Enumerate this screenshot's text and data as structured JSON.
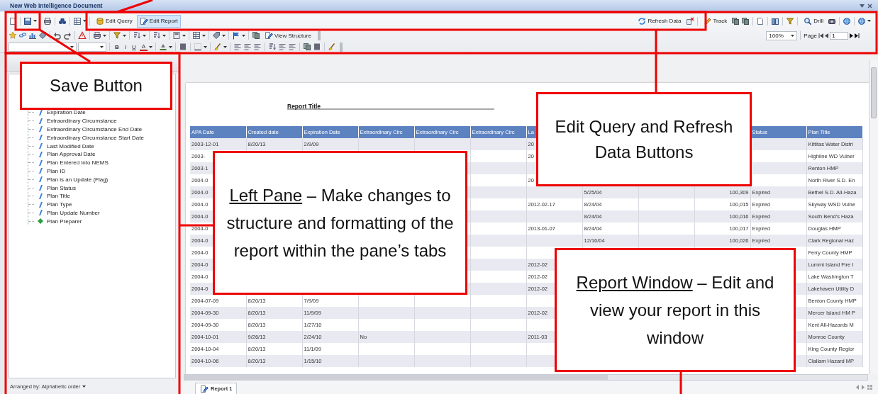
{
  "window": {
    "title": "New Web Intelligence Document"
  },
  "toolbar": {
    "mode_buttons": [
      {
        "label": "Edit Query",
        "selected": false
      },
      {
        "label": "Edit Report",
        "selected": true
      }
    ],
    "refresh_button": {
      "label": "Refresh Data"
    },
    "track_button": {
      "label": "Track"
    },
    "drill_button": {
      "label": "Drill"
    },
    "view_structure_button": {
      "label": "View Structure"
    },
    "zoom": {
      "value": "100%"
    },
    "page_label": "Page",
    "page_field": {
      "value": "1"
    },
    "format_buttons": [
      {
        "label": "B",
        "kind": "bold"
      },
      {
        "label": "I",
        "kind": "italic"
      },
      {
        "label": "U",
        "kind": "underline"
      },
      {
        "label": "A",
        "kind": "color"
      }
    ]
  },
  "left_pane": {
    "objects": [
      {
        "label": "Expiration Date",
        "kind": "detail"
      },
      {
        "label": "Extraordinary Circumstance",
        "kind": "detail"
      },
      {
        "label": "Extraordinary Circumstance End Date",
        "kind": "detail"
      },
      {
        "label": "Extraordinary Circumstance Start Date",
        "kind": "detail"
      },
      {
        "label": "Last Modified Date",
        "kind": "detail"
      },
      {
        "label": "Plan Approval Date",
        "kind": "detail"
      },
      {
        "label": "Plan Entered into NEMS",
        "kind": "detail"
      },
      {
        "label": "Plan ID",
        "kind": "detail"
      },
      {
        "label": "Plan is an Update (Flag)",
        "kind": "detail"
      },
      {
        "label": "Plan Status",
        "kind": "detail"
      },
      {
        "label": "Plan Title",
        "kind": "detail"
      },
      {
        "label": "Plan Type",
        "kind": "detail"
      },
      {
        "label": "Plan Update Number",
        "kind": "detail"
      },
      {
        "label": "Plan Preparer",
        "kind": "dimension"
      }
    ],
    "arranged_by": "Arranged by: Alphabetic order"
  },
  "report": {
    "title": "Report Title",
    "columns": [
      "APA Date",
      "Created date",
      "Expiration Date",
      "Extraordinary Circ",
      "Extraordinary Circ",
      "Extraordinary Circ",
      "La",
      null,
      null,
      null,
      "Status",
      "Plan Title"
    ],
    "rows": [
      [
        "2003-12-01",
        "8/20/13",
        "2/9/09",
        null,
        null,
        null,
        "20",
        null,
        null,
        null,
        null,
        "Kittitas Water Distri"
      ],
      [
        "2003-",
        null,
        null,
        null,
        null,
        null,
        "20",
        null,
        null,
        null,
        null,
        "Highline WD Vulner"
      ],
      [
        "2003-1",
        null,
        null,
        null,
        null,
        null,
        null,
        null,
        null,
        null,
        null,
        "Renton HMP"
      ],
      [
        "2004-0",
        null,
        null,
        null,
        null,
        null,
        "20",
        null,
        null,
        null,
        null,
        "North River S.D. En"
      ],
      [
        "2004-0",
        null,
        null,
        null,
        null,
        null,
        null,
        "5/25/04",
        null,
        "100,309",
        "Expired",
        "Bethel S.D. All-Haza"
      ],
      [
        "2004-0",
        null,
        null,
        null,
        null,
        null,
        "2012-02-17",
        "8/24/04",
        null,
        "100,015",
        "Expired",
        "Skyway WSD Vulne"
      ],
      [
        "2004-0",
        null,
        null,
        null,
        null,
        null,
        null,
        "8/24/04",
        null,
        "100,016",
        "Expired",
        "South Bend's Haza"
      ],
      [
        "2004-0",
        null,
        null,
        null,
        null,
        null,
        "2013-01-07",
        "8/24/04",
        null,
        "100,017",
        "Expired",
        "Douglas HMP"
      ],
      [
        "2004-0",
        null,
        null,
        null,
        null,
        null,
        null,
        "12/16/04",
        null,
        "100,026",
        "Expired",
        "Clark Regional Haz"
      ],
      [
        "2004-0",
        null,
        null,
        null,
        null,
        null,
        null,
        null,
        null,
        null,
        null,
        "Ferry County HMP"
      ],
      [
        "2004-0",
        null,
        null,
        null,
        null,
        null,
        "2012-02",
        null,
        null,
        null,
        null,
        "Lummi Island Fire I"
      ],
      [
        "2004-0",
        null,
        null,
        null,
        null,
        null,
        "2012-02",
        null,
        null,
        null,
        null,
        "Lake Washington T"
      ],
      [
        "2004-0",
        null,
        null,
        null,
        null,
        null,
        "2012-02",
        null,
        null,
        null,
        null,
        "Lakehaven Utility D"
      ],
      [
        "2004-07-09",
        "8/20/13",
        "7/9/09",
        null,
        null,
        null,
        null,
        null,
        null,
        null,
        null,
        "Benton County HMP"
      ],
      [
        "2004-09-30",
        "8/20/13",
        "11/9/09",
        null,
        null,
        null,
        "2012-02",
        null,
        null,
        null,
        null,
        "Mercer Island HM P"
      ],
      [
        "2004-09-30",
        "8/20/13",
        "1/27/10",
        null,
        null,
        null,
        null,
        null,
        null,
        null,
        null,
        "Kent All-Hazards M"
      ],
      [
        "2004-10-01",
        "9/26/13",
        "2/24/10",
        "No",
        null,
        null,
        "2011-03",
        null,
        null,
        null,
        null,
        "Monroe County"
      ],
      [
        "2004-10-04",
        "8/20/13",
        "11/1/09",
        null,
        null,
        null,
        null,
        null,
        null,
        null,
        null,
        "King County Regior"
      ],
      [
        "2004-10-06",
        "8/20/13",
        "1/15/10",
        null,
        null,
        null,
        null,
        null,
        null,
        null,
        null,
        "Clallam Hazard MP"
      ]
    ],
    "tabs": [
      {
        "label": "Report 1",
        "selected": true
      }
    ]
  },
  "callouts": [
    {
      "kind": "plain",
      "text": "Save Button"
    },
    {
      "kind": "plain",
      "text": "Edit Query and Refresh Data Buttons"
    },
    {
      "kind": "headed",
      "heading": "Left Pane",
      "text": "– Make changes to structure and formatting of the report within the pane’s tabs"
    },
    {
      "kind": "headed",
      "heading": "Report Window",
      "text": "– Edit and view your report in this window"
    }
  ]
}
